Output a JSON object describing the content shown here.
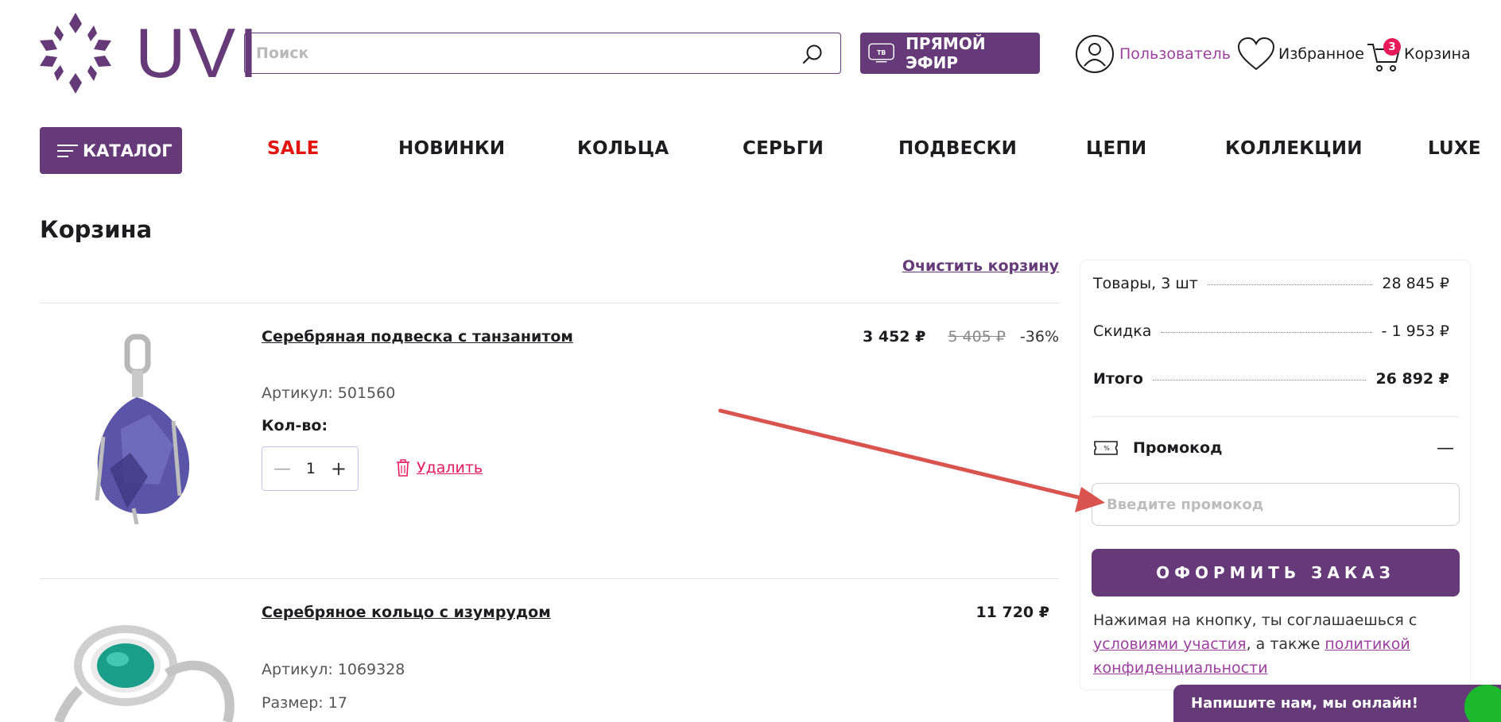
{
  "header": {
    "logo_text": "UVI",
    "search_placeholder": "Поиск",
    "live_button": "ПРЯМОЙ ЭФИР",
    "live_badge": "ТВ",
    "user_label": "Пользователь",
    "favorites_label": "Избранное",
    "cart_label": "Корзина",
    "cart_count": "3"
  },
  "nav": {
    "catalog": "КАТАЛОГ",
    "items": [
      "SALE",
      "НОВИНКИ",
      "КОЛЬЦА",
      "СЕРЬГИ",
      "ПОДВЕСКИ",
      "ЦЕПИ",
      "КОЛЛЕКЦИИ",
      "LUXE"
    ]
  },
  "page": {
    "title": "Корзина",
    "clear_cart": "Очистить корзину"
  },
  "items": [
    {
      "title": "Серебряная подвеска с танзанитом",
      "sku": "Артикул: 501560",
      "price": "3 452 ₽",
      "old_price": "5 405 ₽",
      "discount": "-36%",
      "qty_label": "Кол-во:",
      "qty": "1",
      "minus": "—",
      "plus": "+",
      "delete": "Удалить"
    },
    {
      "title": "Серебряное кольцо с изумрудом",
      "sku": "Артикул: 1069328",
      "price": "11 720 ₽",
      "size": "Размер: 17"
    }
  ],
  "summary": {
    "goods_label": "Товары, 3 шт",
    "goods_value": "28 845 ₽",
    "discount_label": "Скидка",
    "discount_value": "- 1 953 ₽",
    "total_label": "Итого",
    "total_value": "26 892 ₽",
    "promo_label": "Промокод",
    "promo_toggle": "—",
    "promo_placeholder": "Введите промокод",
    "order_button": "ОФОРМИТЬ ЗАКАЗ",
    "agree_text": "Нажимая на кнопку, ты соглашаешься с ",
    "terms_link": "условиями участия",
    "agree_mid": ", а также ",
    "privacy_link": "политикой конфиденциальности"
  },
  "chat": {
    "label": "Напишите нам, мы онлайн!"
  },
  "colors": {
    "brand": "#663a78",
    "sale": "#e3130e",
    "accent_pink": "#e8195b",
    "annotation_arrow": "#d9534f",
    "chat_online": "#1cb82e"
  }
}
